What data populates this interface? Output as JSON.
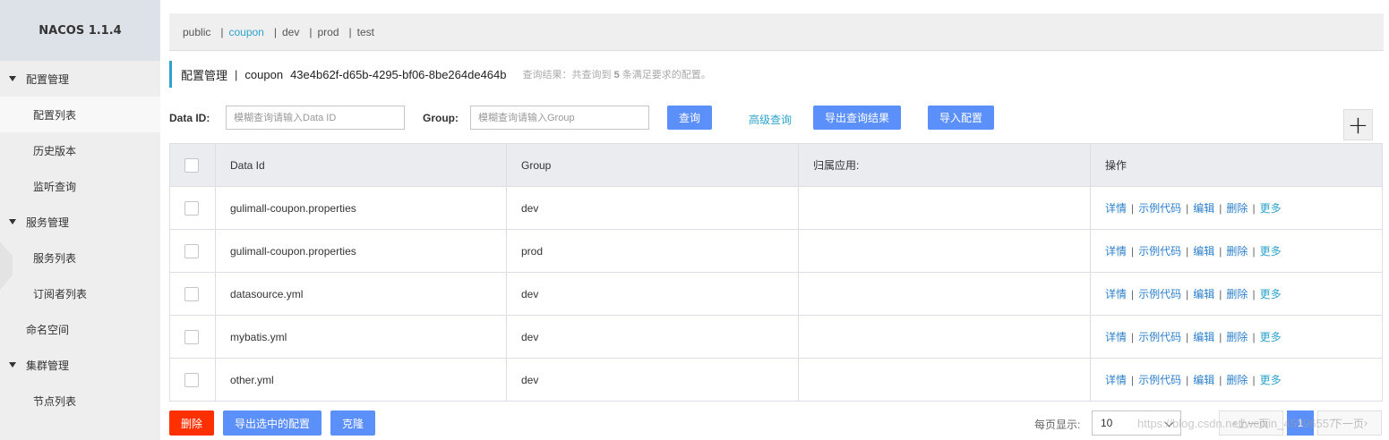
{
  "app": {
    "title": "NACOS 1.1.4"
  },
  "sidebar": {
    "groups": [
      {
        "label": "配置管理",
        "items": [
          "配置列表",
          "历史版本",
          "监听查询"
        ]
      },
      {
        "label": "服务管理",
        "items": [
          "服务列表",
          "订阅者列表"
        ]
      },
      {
        "label": "命名空间"
      },
      {
        "label": "集群管理",
        "items": [
          "节点列表"
        ]
      }
    ]
  },
  "namespaces": [
    "public",
    "coupon",
    "dev",
    "prod",
    "test"
  ],
  "active_namespace": "coupon",
  "header": {
    "title": "配置管理",
    "sep": "|",
    "namespace": "coupon",
    "namespace_id": "43e4b62f-d65b-4295-bf06-8be264de464b",
    "result_prefix": "查询结果：共查询到",
    "result_count": "5",
    "result_suffix": "条满足要求的配置。"
  },
  "search": {
    "dataid_label": "Data ID:",
    "dataid_placeholder": "模糊查询请输入Data ID",
    "group_label": "Group:",
    "group_placeholder": "模糊查询请输入Group",
    "query_button": "查询",
    "advanced_link": "高级查询",
    "export_button": "导出查询结果",
    "import_button": "导入配置",
    "add_icon": "+"
  },
  "table": {
    "columns": [
      "Data Id",
      "Group",
      "归属应用:",
      "操作"
    ],
    "rows": [
      {
        "data_id": "gulimall-coupon.properties",
        "group": "dev",
        "app": ""
      },
      {
        "data_id": "gulimall-coupon.properties",
        "group": "prod",
        "app": ""
      },
      {
        "data_id": "datasource.yml",
        "group": "dev",
        "app": ""
      },
      {
        "data_id": "mybatis.yml",
        "group": "dev",
        "app": ""
      },
      {
        "data_id": "other.yml",
        "group": "dev",
        "app": ""
      }
    ],
    "actions": [
      "详情",
      "示例代码",
      "编辑",
      "删除",
      "更多"
    ]
  },
  "footer": {
    "delete_button": "删除",
    "export_selected_button": "导出选中的配置",
    "clone_button": "克隆",
    "per_page_label": "每页显示:",
    "per_page_value": "10",
    "prev_label": "上一页",
    "current_page": "1",
    "next_label": "下一页",
    "watermark": "https://blog.csdn.net/weixin_45996557"
  },
  "colors": {
    "primary": "#5b8ff9",
    "accent": "#2ea3c8",
    "danger": "#ff3000",
    "link": "#2e7fc8"
  }
}
